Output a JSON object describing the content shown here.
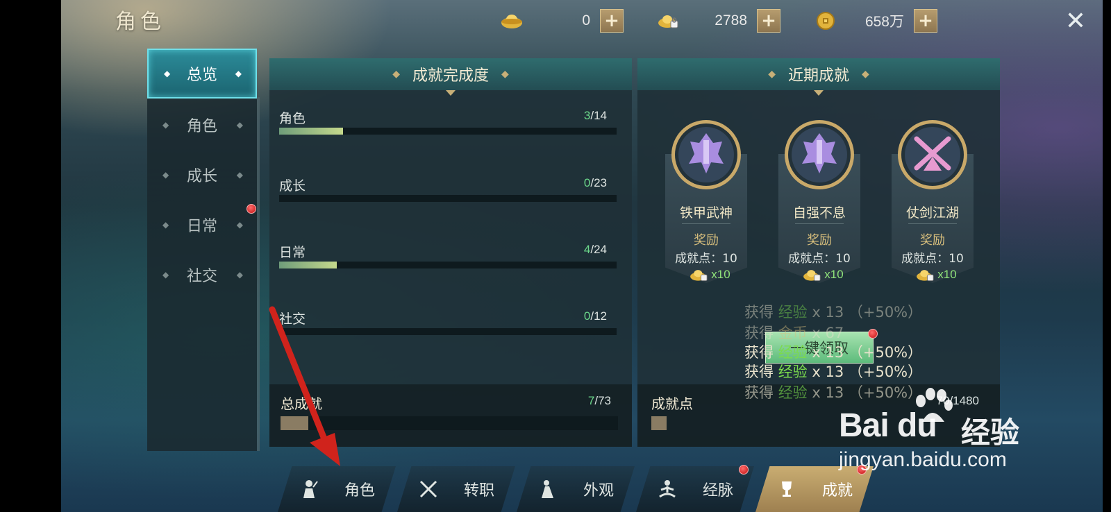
{
  "header": {
    "title": "角色",
    "currencies": [
      {
        "icon": "gold-ingot-icon",
        "value": "0"
      },
      {
        "icon": "bound-ingot-icon",
        "value": "2788"
      },
      {
        "icon": "coin-icon",
        "value": "658万"
      }
    ],
    "plus_label": "+",
    "close_label": "✕"
  },
  "side_nav": {
    "items": [
      {
        "label": "总览",
        "active": true
      },
      {
        "label": "角色",
        "active": false
      },
      {
        "label": "成长",
        "active": false
      },
      {
        "label": "日常",
        "active": false,
        "badge": true
      },
      {
        "label": "社交",
        "active": false
      }
    ]
  },
  "completion": {
    "title": "成就完成度",
    "rows": [
      {
        "label": "角色",
        "done": "3",
        "total": "/14",
        "progress": 0.19
      },
      {
        "label": "成长",
        "done": "0",
        "total": "/23",
        "progress": 0
      },
      {
        "label": "日常",
        "done": "4",
        "total": "/24",
        "progress": 0.17
      },
      {
        "label": "社交",
        "done": "0",
        "total": "/12",
        "progress": 0
      }
    ],
    "total": {
      "label": "总成就",
      "done": "7",
      "total": "/73"
    }
  },
  "recent": {
    "title": "近期成就",
    "cards": [
      {
        "name": "铁甲武神",
        "reward_label": "奖励",
        "points": "成就点：10",
        "gift_qty": "x10",
        "emblem_color": "#a98de0"
      },
      {
        "name": "自强不息",
        "reward_label": "奖励",
        "points": "成就点：10",
        "gift_qty": "x10",
        "emblem_color": "#a98de0"
      },
      {
        "name": "仗剑江湖",
        "reward_label": "奖励",
        "points": "成就点：10",
        "gift_qty": "x10",
        "emblem_color": "#e79ad0"
      }
    ],
    "points_total": {
      "label": "成就点",
      "value": "70/1480"
    },
    "claim_button": "一键领取"
  },
  "gain_messages": [
    {
      "prefix": "获得 ",
      "item": "经验",
      "amount": " x 13",
      "bonus": " （+50%）",
      "faded": true
    },
    {
      "prefix": "获得 ",
      "item": "金币",
      "amount": " x 67",
      "bonus": "",
      "faded": true
    },
    {
      "prefix": "获得 ",
      "item": "经验",
      "amount": " x 13",
      "bonus": " （+50%）",
      "faded": false
    },
    {
      "prefix": "获得 ",
      "item": "经验",
      "amount": " x 13",
      "bonus": " （+50%）",
      "faded": false
    },
    {
      "prefix": "获得 ",
      "item": "经验",
      "amount": " x 13",
      "bonus": " （+50%）",
      "faded": true
    }
  ],
  "bottom_tabs": [
    {
      "label": "角色",
      "icon": "character-icon",
      "active": false
    },
    {
      "label": "转职",
      "icon": "crossed-swords-icon",
      "active": false
    },
    {
      "label": "外观",
      "icon": "outfit-icon",
      "active": false
    },
    {
      "label": "经脉",
      "icon": "meditation-icon",
      "active": false,
      "badge": true
    },
    {
      "label": "成就",
      "icon": "trophy-icon",
      "active": true,
      "badge": true
    }
  ],
  "watermark": {
    "logo": "Bai  du",
    "logo_cn": "经验",
    "url": "jingyan.baidu.com"
  },
  "colors": {
    "accent_teal": "#2c8c9a",
    "progress": "#c5d98c",
    "gold": "#d8bf7d",
    "green_text": "#6bd78a"
  }
}
